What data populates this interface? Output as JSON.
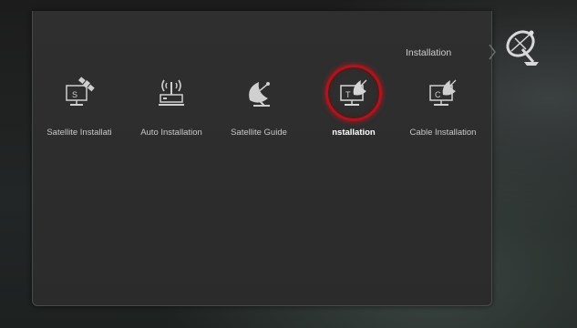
{
  "header": {
    "title": "Installation",
    "icon": "satellite-dish-icon"
  },
  "menu": {
    "selected_index": 3,
    "items": [
      {
        "label": "Satellite Installati",
        "icon": "satellite-tv-icon",
        "badge": "S"
      },
      {
        "label": "Auto Installation",
        "icon": "antenna-tower-icon",
        "badge": ""
      },
      {
        "label": "Satellite Guide",
        "icon": "dish-icon",
        "badge": ""
      },
      {
        "label": "nstallation",
        "icon": "terrestrial-tv-icon",
        "badge": "T"
      },
      {
        "label": "Cable Installation",
        "icon": "cable-tv-icon",
        "badge": "C"
      }
    ]
  },
  "colors": {
    "panel": "#2d2d2d",
    "text": "#c8c8c8",
    "highlight_ring": "#b3121a"
  }
}
